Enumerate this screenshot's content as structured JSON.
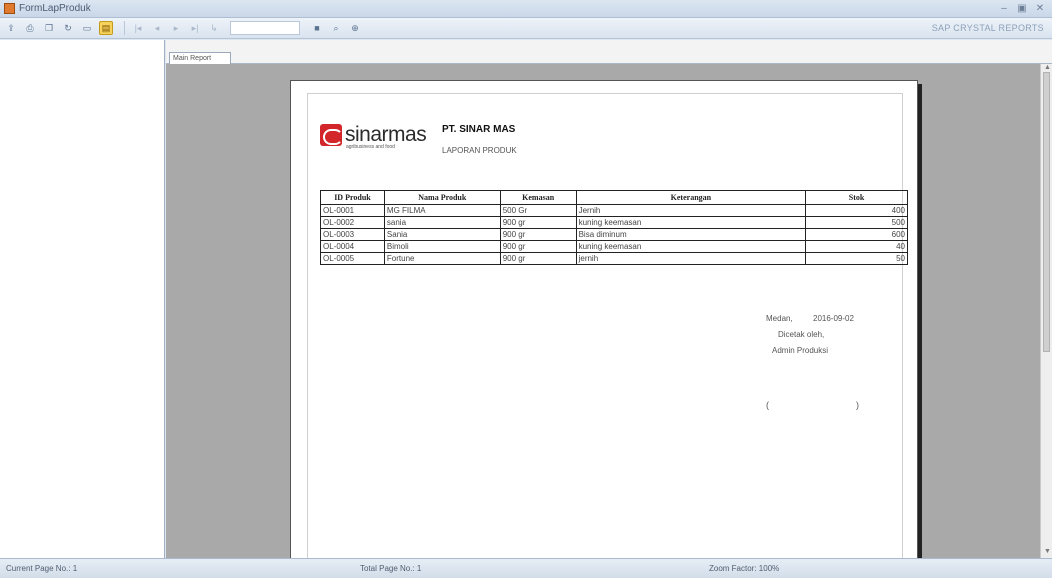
{
  "window": {
    "title": "FormLapProduk"
  },
  "toolbar": {
    "brand_text": "SAP CRYSTAL REPORTS"
  },
  "tabs": [
    {
      "label": "Main Report"
    }
  ],
  "report": {
    "logo_text": "sinarmas",
    "logo_subtext": "agribusiness and food",
    "company": "PT. SINAR MAS",
    "title": "LAPORAN PRODUK",
    "columns": [
      "ID Produk",
      "Nama Produk",
      "Kemasan",
      "Keterangan",
      "Stok"
    ],
    "rows": [
      [
        "OL-0001",
        "MG FILMA",
        "500 Gr",
        "Jernih",
        "400"
      ],
      [
        "OL-0002",
        "sania",
        "900 gr",
        "kuning keemasan",
        "500"
      ],
      [
        "OL-0003",
        "Sania",
        "900 gr",
        "Bisa diminum",
        "600"
      ],
      [
        "OL-0004",
        "Bimoli",
        "900 gr",
        "kuning keemasan",
        "40"
      ],
      [
        "OL-0005",
        "Fortune",
        "900 gr",
        "jernih",
        "50"
      ]
    ],
    "signature": {
      "city": "Medan,",
      "date": "2016-09-02",
      "printed_by": "Dicetak oleh,",
      "role": "Admin Produksi",
      "bracket_open": "(",
      "bracket_close": ")"
    }
  },
  "status": {
    "current_page": "Current Page No.: 1",
    "total_page": "Total Page No.: 1",
    "zoom": "Zoom Factor: 100%"
  }
}
